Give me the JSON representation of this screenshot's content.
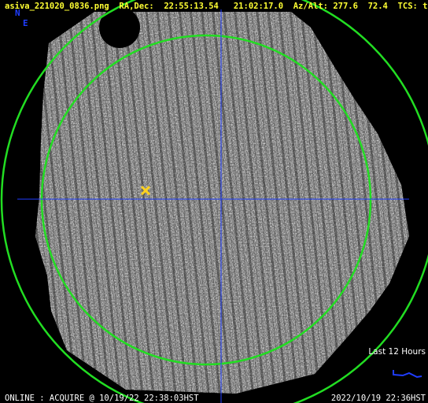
{
  "header": {
    "filename": "asiva_221020_0836.png",
    "radec_label": "RA,Dec:",
    "ra": "22:55:13.54",
    "dec": "21:02:17.0",
    "azalt_label": "Az/Alt:",
    "az": "277.6",
    "alt": "72.4",
    "tcs_label": "TCS:",
    "tcs": "track"
  },
  "compass": {
    "north": "N",
    "east": "E"
  },
  "legend": {
    "label": "Last 12 Hours"
  },
  "footer": {
    "status": "ONLINE : ACQUIRE @ 10/19/22 22:38:03HST",
    "timestamp": "2022/10/19 22:36HST"
  },
  "colors": {
    "header_text": "#ffff33",
    "horizon_circle": "#22dd22",
    "crosshair": "#1f3dff",
    "target_marker": "#ffd21f"
  },
  "icons": {
    "target": "x-target-icon"
  }
}
